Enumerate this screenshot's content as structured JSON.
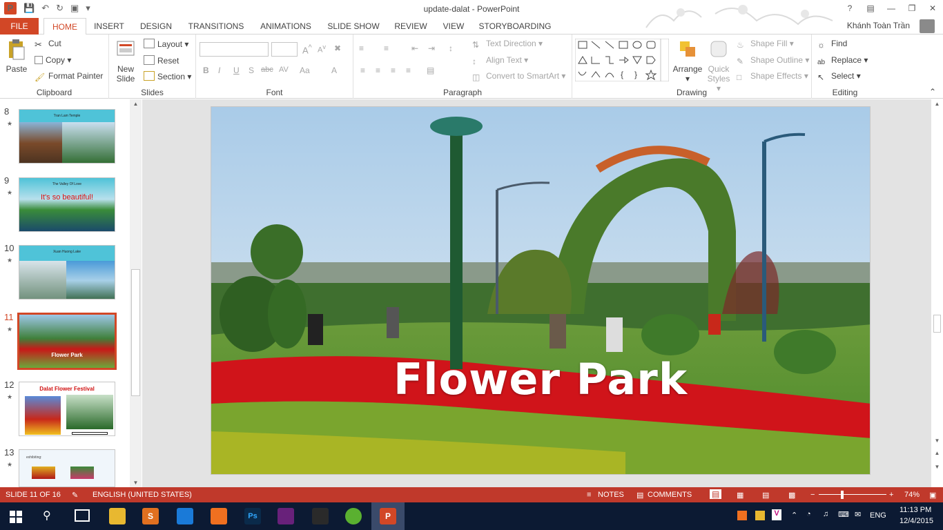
{
  "window": {
    "title": "update-dalat - PowerPoint",
    "user": "Khánh Toàn Trần"
  },
  "tabs": [
    {
      "label": "FILE"
    },
    {
      "label": "HOME"
    },
    {
      "label": "INSERT"
    },
    {
      "label": "DESIGN"
    },
    {
      "label": "TRANSITIONS"
    },
    {
      "label": "ANIMATIONS"
    },
    {
      "label": "SLIDE SHOW"
    },
    {
      "label": "REVIEW"
    },
    {
      "label": "VIEW"
    },
    {
      "label": "STORYBOARDING"
    }
  ],
  "ribbon": {
    "clipboard": {
      "paste": "Paste",
      "cut": "Cut",
      "copy": "Copy",
      "format_painter": "Format Painter",
      "label": "Clipboard"
    },
    "slides": {
      "new_slide_1": "New",
      "new_slide_2": "Slide",
      "layout": "Layout",
      "reset": "Reset",
      "section": "Section",
      "label": "Slides"
    },
    "font": {
      "label": "Font"
    },
    "paragraph": {
      "text_direction": "Text Direction",
      "align_text": "Align Text",
      "convert_smartart": "Convert to SmartArt",
      "label": "Paragraph"
    },
    "drawing": {
      "arrange": "Arrange",
      "quick_styles_1": "Quick",
      "quick_styles_2": "Styles",
      "shape_fill": "Shape Fill",
      "shape_outline": "Shape Outline",
      "shape_effects": "Shape Effects",
      "label": "Drawing"
    },
    "editing": {
      "find": "Find",
      "replace": "Replace",
      "select": "Select",
      "label": "Editing"
    }
  },
  "thumbnails": [
    {
      "num": "8",
      "title": "Tran Lam Temple"
    },
    {
      "num": "9",
      "title": "The Valley Of Love",
      "sub": "It's so beautiful!"
    },
    {
      "num": "10",
      "title": "Xuan Huong Lake"
    },
    {
      "num": "11",
      "title": "Flower Park",
      "selected": true
    },
    {
      "num": "12",
      "title": "Dalat Flower Festival"
    },
    {
      "num": "13",
      "title": "exhibiting:"
    }
  ],
  "slide": {
    "title": "Flower Park"
  },
  "status": {
    "slide_info": "SLIDE 11 OF 16",
    "language": "ENGLISH (UNITED STATES)",
    "notes": "NOTES",
    "comments": "COMMENTS",
    "zoom": "74%"
  },
  "taskbar": {
    "time": "11:13 PM",
    "date": "12/4/2015",
    "lang": "ENG"
  },
  "colors": {
    "accent": "#d24726",
    "statusbar": "#c0392b",
    "taskbar": "#0c1a33"
  }
}
